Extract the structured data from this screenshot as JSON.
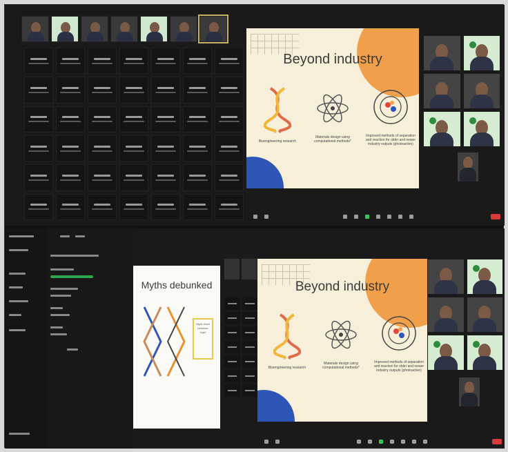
{
  "top_slide": {
    "title": "Beyond industry",
    "items": [
      {
        "caption": "Bioengineering research",
        "icon": "dna-icon"
      },
      {
        "caption": "Materials design using computational methods*",
        "icon": "atom-icon"
      },
      {
        "caption": "Improved methods of separation and reaction for older and newer industry outputs (photoactive)",
        "icon": "orbit-icon"
      }
    ]
  },
  "bottom_slide": {
    "title": "Beyond industry",
    "items": [
      {
        "caption": "Bioengineering research",
        "icon": "dna-icon"
      },
      {
        "caption": "Materials design using computational methods*",
        "icon": "atom-icon"
      },
      {
        "caption": "Improved methods of separation and reaction for older and newer industry outputs (photoactive)",
        "icon": "orbit-icon"
      }
    ]
  },
  "myths_slide": {
    "title": "Myths debunked",
    "side_label": "Myth: fixed behavior 'rigid'"
  },
  "colors": {
    "accent_green": "#34c759",
    "end_red": "#d63a3a",
    "slide_bg": "#f7efd9",
    "slide_orange": "#f0a04b",
    "slide_blue": "#2d56b6"
  }
}
